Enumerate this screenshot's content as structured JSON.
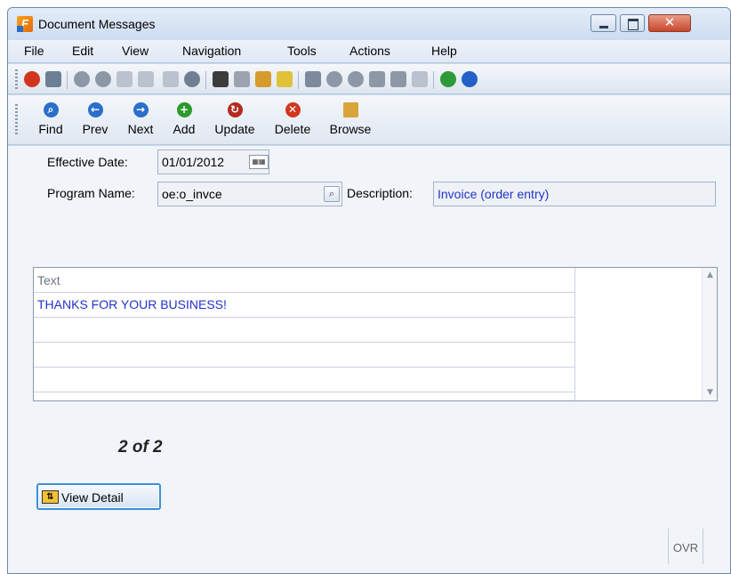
{
  "window": {
    "title": "Document Messages"
  },
  "menu": [
    "File",
    "Edit",
    "View",
    "Navigation",
    "Tools",
    "Actions",
    "Help"
  ],
  "nav_buttons": [
    {
      "label": "Find",
      "icon": "search-icon",
      "color": "#2a6fc9"
    },
    {
      "label": "Prev",
      "icon": "arrow-left-icon",
      "color": "#2a6fc9"
    },
    {
      "label": "Next",
      "icon": "arrow-right-icon",
      "color": "#2a6fc9"
    },
    {
      "label": "Add",
      "icon": "plus-icon",
      "color": "#2c9a2c"
    },
    {
      "label": "Update",
      "icon": "refresh-icon",
      "color": "#b52a1f"
    },
    {
      "label": "Delete",
      "icon": "close-icon",
      "color": "#d0371f"
    },
    {
      "label": "Browse",
      "icon": "folder-icon",
      "color": "#d9a43a"
    }
  ],
  "form": {
    "effective_date_label": "Effective Date:",
    "effective_date_value": "01/01/2012",
    "program_name_label": "Program Name:",
    "program_name_value": "oe:o_invce",
    "description_label": "Description:",
    "description_value": "Invoice (order entry)"
  },
  "grid": {
    "column_header": "Text",
    "rows": [
      "THANKS FOR YOUR BUSINESS!",
      "",
      "",
      ""
    ]
  },
  "record_count": "2 of 2",
  "view_detail_label": "View Detail",
  "status": {
    "mode": "OVR"
  },
  "colors": {
    "accent_text": "#2233cc",
    "window_frame": "#6f8aa8"
  }
}
